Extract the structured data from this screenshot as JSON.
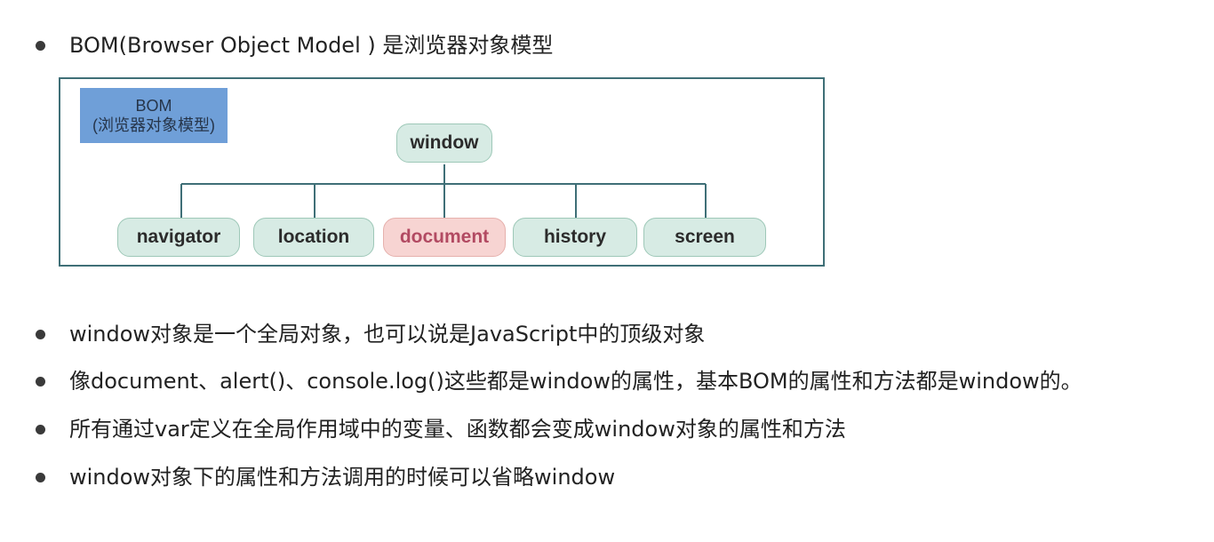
{
  "intro": {
    "text": "BOM(Browser Object Model ) 是浏览器对象模型"
  },
  "diagram": {
    "label_line1": "BOM",
    "label_line2": "(浏览器对象模型)",
    "root": "window",
    "children": [
      "navigator",
      "location",
      "document",
      "history",
      "screen"
    ],
    "highlighted_child": "document",
    "colors": {
      "node_fill": "#d7ebe4",
      "highlight_fill": "#f7d4d2",
      "label_fill": "#6f9fd8",
      "line": "#3f6f77"
    }
  },
  "bullets": [
    "window对象是一个全局对象，也可以说是JavaScript中的顶级对象",
    "像document、alert()、console.log()这些都是window的属性，基本BOM的属性和方法都是window的。",
    "所有通过var定义在全局作用域中的变量、函数都会变成window对象的属性和方法",
    "window对象下的属性和方法调用的时候可以省略window"
  ]
}
